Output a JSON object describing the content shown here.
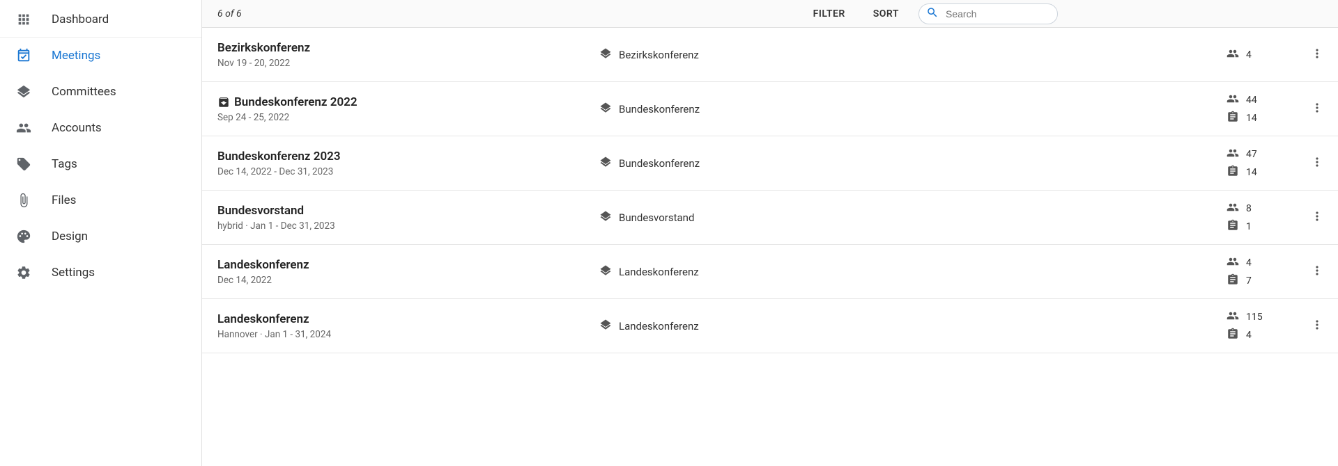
{
  "sidebar": {
    "items": [
      {
        "label": "Dashboard"
      },
      {
        "label": "Meetings"
      },
      {
        "label": "Committees"
      },
      {
        "label": "Accounts"
      },
      {
        "label": "Tags"
      },
      {
        "label": "Files"
      },
      {
        "label": "Design"
      },
      {
        "label": "Settings"
      }
    ]
  },
  "topbar": {
    "count": "6 of 6",
    "filter": "FILTER",
    "sort": "SORT",
    "search_placeholder": "Search"
  },
  "meetings": [
    {
      "title": "Bezirkskonferenz",
      "has_archive_icon": false,
      "subtitle": "Nov 19 - 20, 2022",
      "committee": "Bezirkskonferenz",
      "people": "4",
      "docs": null
    },
    {
      "title": "Bundeskonferenz 2022",
      "has_archive_icon": true,
      "subtitle": "Sep 24 - 25, 2022",
      "committee": "Bundeskonferenz",
      "people": "44",
      "docs": "14"
    },
    {
      "title": "Bundeskonferenz 2023",
      "has_archive_icon": false,
      "subtitle": "Dec 14, 2022 - Dec 31, 2023",
      "committee": "Bundeskonferenz",
      "people": "47",
      "docs": "14"
    },
    {
      "title": "Bundesvorstand",
      "has_archive_icon": false,
      "subtitle": "hybrid  ·  Jan 1 - Dec 31, 2023",
      "committee": "Bundesvorstand",
      "people": "8",
      "docs": "1"
    },
    {
      "title": "Landeskonferenz",
      "has_archive_icon": false,
      "subtitle": "Dec 14, 2022",
      "committee": "Landeskonferenz",
      "people": "4",
      "docs": "7"
    },
    {
      "title": "Landeskonferenz",
      "has_archive_icon": false,
      "subtitle": "Hannover  ·  Jan 1 - 31, 2024",
      "committee": "Landeskonferenz",
      "people": "115",
      "docs": "4"
    }
  ]
}
